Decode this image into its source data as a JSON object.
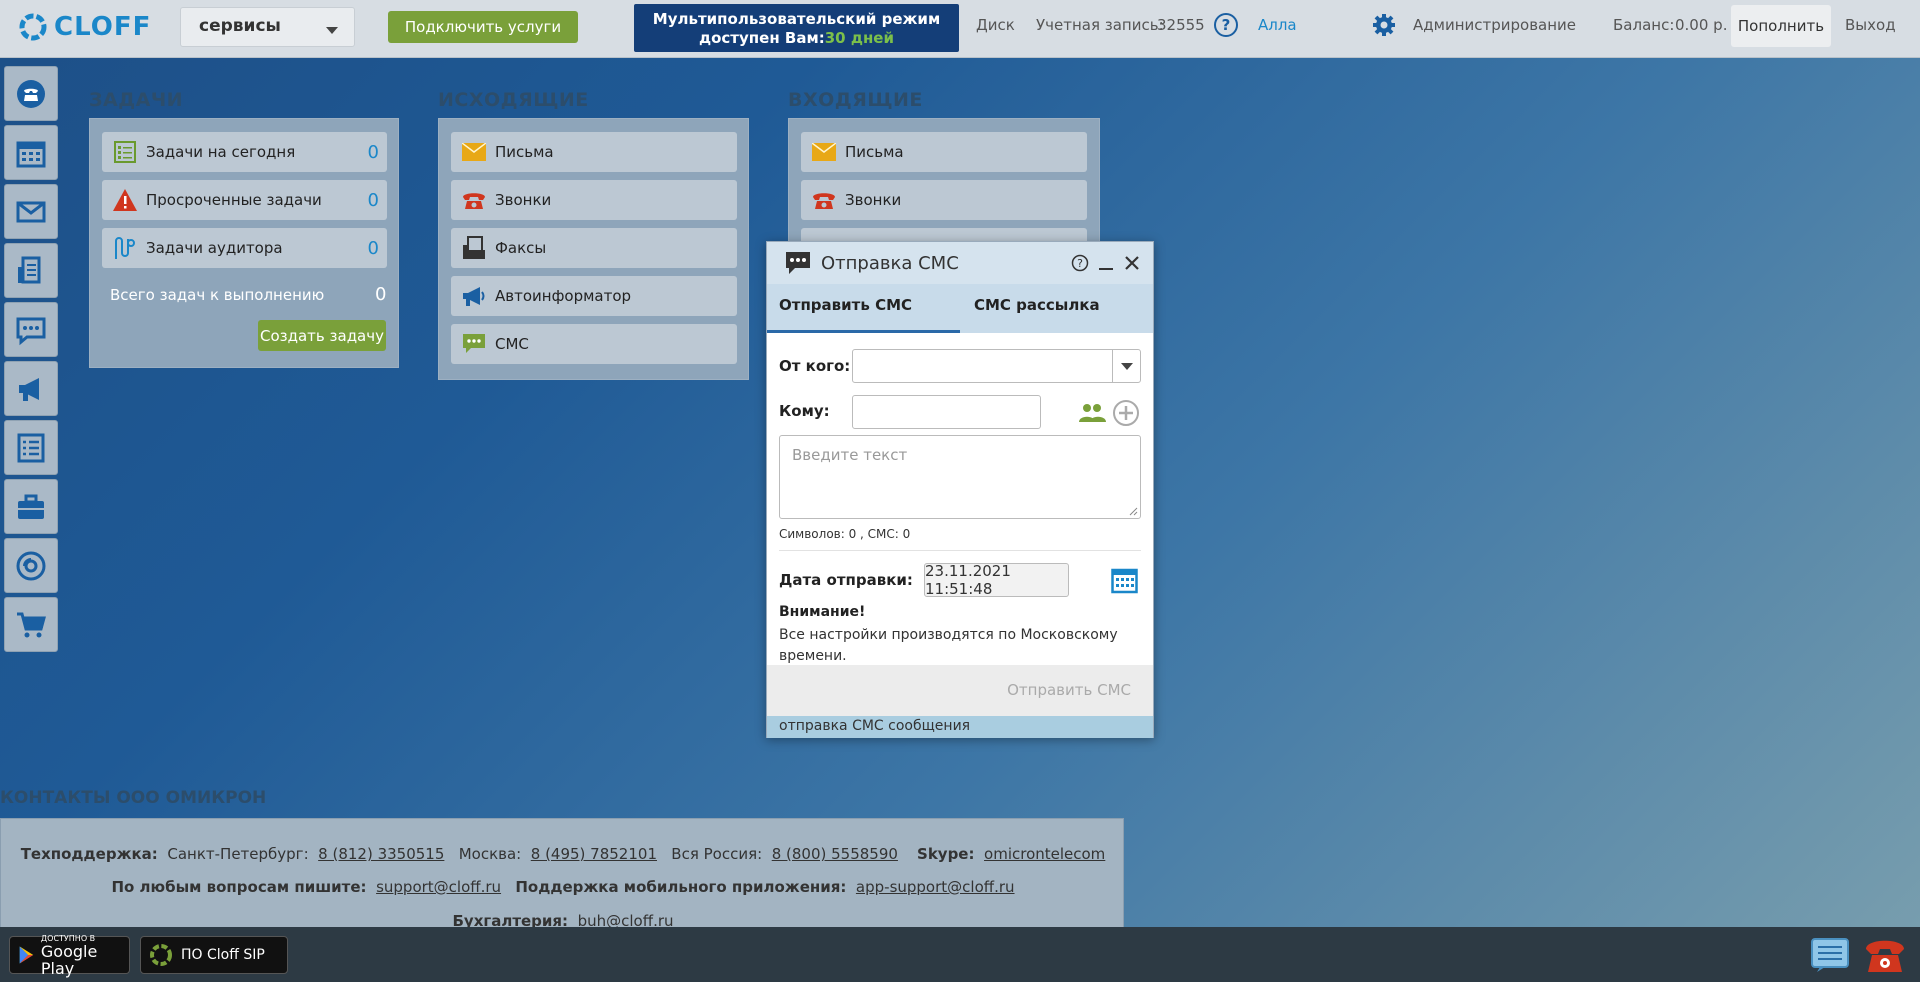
{
  "header": {
    "logo_text": "CLOFF",
    "service_select": "сервисы",
    "connect_label": "Подключить услуги",
    "multi_line1": "Мультипользовательский режим",
    "multi_line2": "доступен Вам:",
    "multi_days": "30 дней",
    "disk": "Диск",
    "account_label": "Учетная запись:",
    "account_number": "32555",
    "help": "?",
    "user": "Алла",
    "admin": "Администрирование",
    "balance_label": "Баланс:",
    "balance_value": "0.00 р.",
    "topup": "Пополнить",
    "logout": "Выход"
  },
  "sidebar": {
    "items": [
      "phone-icon",
      "calendar-icon",
      "mail-icon",
      "fax-icon",
      "chat-icon",
      "megaphone-icon",
      "checklist-icon",
      "briefcase-icon",
      "disc-icon",
      "cart-icon"
    ]
  },
  "tasks": {
    "title": "ЗАДАЧИ",
    "rows": [
      {
        "label": "Задачи на сегодня",
        "count": "0"
      },
      {
        "label": "Просроченные задачи",
        "count": "0"
      },
      {
        "label": "Задачи аудитора",
        "count": "0"
      }
    ],
    "total_label": "Всего задач к выполнению",
    "total_count": "0",
    "create_label": "Создать задачу"
  },
  "outgoing": {
    "title": "ИСХОДЯЩИЕ",
    "rows": [
      "Письма",
      "Звонки",
      "Факсы",
      "Автоинформатор",
      "СМС"
    ]
  },
  "incoming": {
    "title": "ВХОДЯЩИЕ",
    "rows": [
      "Письма",
      "Звонки"
    ]
  },
  "sms_modal": {
    "title": "Отправка СМС",
    "tab_send": "Отправить СМС",
    "tab_mass": "СМС рассылка",
    "from_label": "От кого:",
    "from_value": "",
    "to_label": "Кому:",
    "to_value": "",
    "text_placeholder": "Введите текст",
    "counter": "Символов: 0 , СМС: 0",
    "date_label": "Дата отправки:",
    "date_value": "23.11.2021 11:51:48",
    "warn_title": "Внимание!",
    "warn_text": "Все настройки производятся по Московскому времени.",
    "send_label": "Отправить СМС",
    "status": "отправка СМС сообщения"
  },
  "contacts": {
    "title": "КОНТАКТЫ ООО ОМИКРОН",
    "support_label": "Техподдержка:",
    "spb_label": "Санкт-Петербург:",
    "spb_phone": "8 (812) 3350515",
    "msk_label": "Москва:",
    "msk_phone": "8 (495) 7852101",
    "ru_label": "Вся Россия:",
    "ru_phone": "8 (800) 5558590",
    "skype_label": "Skype:",
    "skype_value": "omicrontelecom",
    "write_label": "По любым вопросам пишите:",
    "support_email": "support@cloff.ru",
    "mobile_label": "Поддержка мобильного приложения:",
    "mobile_email": "app-support@cloff.ru",
    "buh_label": "Бухгалтерия:",
    "buh_email": "buh@cloff.ru"
  },
  "bottom": {
    "gplay_small": "ДОСТУПНО В",
    "gplay_big": "Google Play",
    "sip_label": "ПО Cloff SIP"
  },
  "colors": {
    "accent_blue": "#1a87c9",
    "button_green": "#7aa03a",
    "banner_navy": "#143e78"
  }
}
